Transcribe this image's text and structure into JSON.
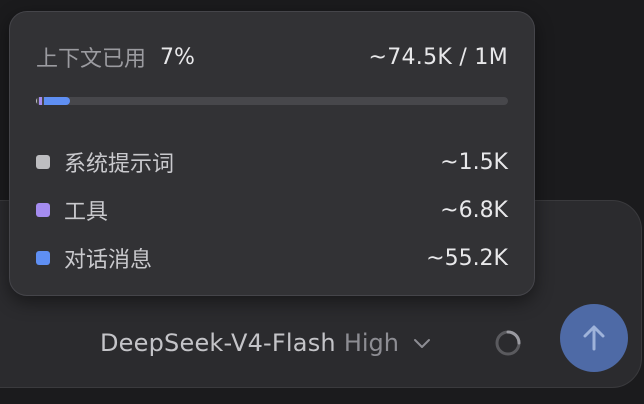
{
  "composer": {
    "model_name": "DeepSeek-V4-Flash",
    "effort": "High",
    "send_color": "#4e6aa6"
  },
  "context_usage": {
    "title": "上下文已用",
    "percent": "7%",
    "total": "~74.5K / 1M",
    "bar": {
      "segments": [
        {
          "name": "系统提示词",
          "fraction": 0.0015,
          "color": "#bdbdc0"
        },
        {
          "name": "工具",
          "fraction": 0.0068,
          "color": "#a58cf0"
        },
        {
          "name": "对话消息",
          "fraction": 0.0552,
          "color": "#5f8ff3"
        }
      ]
    },
    "items": [
      {
        "label": "系统提示词",
        "value": "~1.5K",
        "color": "#bdbdc0"
      },
      {
        "label": "工具",
        "value": "~6.8K",
        "color": "#a58cf0"
      },
      {
        "label": "对话消息",
        "value": "~55.2K",
        "color": "#5f8ff3"
      }
    ]
  }
}
